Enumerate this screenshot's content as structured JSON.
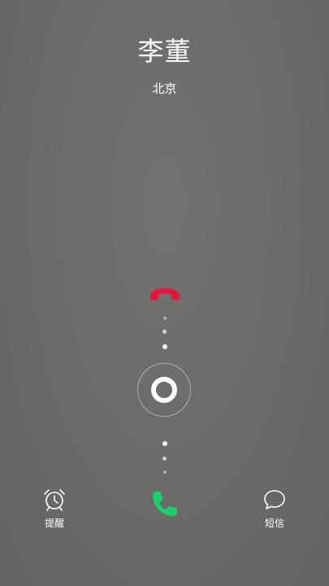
{
  "caller": {
    "name": "李董",
    "location": "北京"
  },
  "actions": {
    "remind_label": "提醒",
    "message_label": "短信"
  },
  "icons": {
    "decline": "phone-hangup-icon",
    "answer": "phone-answer-icon",
    "remind": "alarm-clock-icon",
    "message": "chat-bubble-icon"
  },
  "colors": {
    "decline": "#e8163a",
    "answer": "#17d36b",
    "text": "#ffffff"
  }
}
